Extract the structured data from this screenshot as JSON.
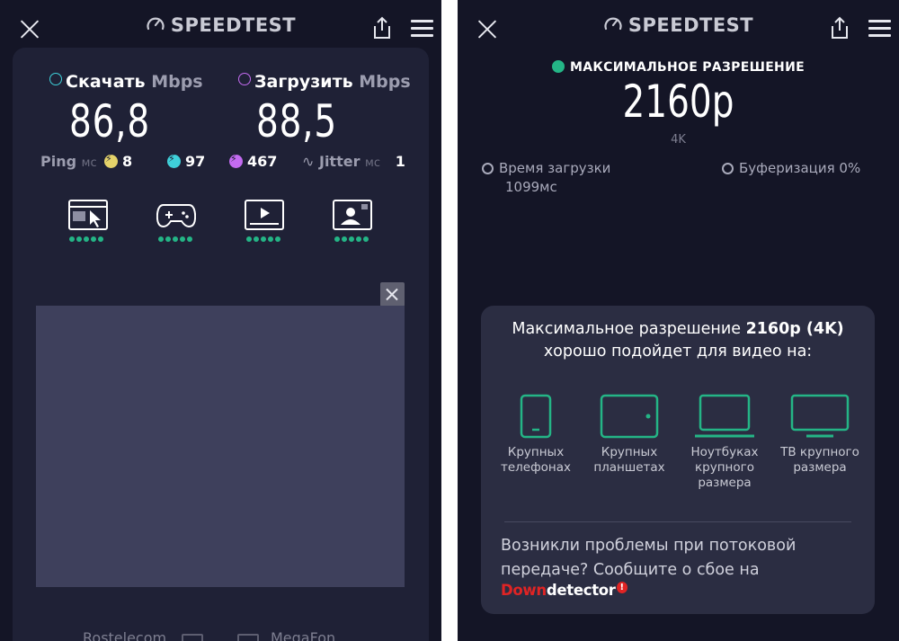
{
  "brand": "SPEEDTEST",
  "left": {
    "download": {
      "label": "Скачать",
      "unit": "Mbps",
      "value": "86,8"
    },
    "upload": {
      "label": "Загрузить",
      "unit": "Mbps",
      "value": "88,5"
    },
    "ping": {
      "label": "Ping",
      "unit": "мс",
      "idle": "8",
      "download": "97",
      "upload": "467"
    },
    "jitter": {
      "label": "Jitter",
      "unit": "мс",
      "value": "1"
    },
    "activities": [
      {
        "name": "web-browsing",
        "rating": 5
      },
      {
        "name": "gaming",
        "rating": 5
      },
      {
        "name": "video-streaming",
        "rating": 5
      },
      {
        "name": "video-chat",
        "rating": 5
      }
    ],
    "providers": [
      "Rostelecom",
      "MegaFon"
    ]
  },
  "right": {
    "title": "МАКСИМАЛЬНОЕ РАЗРЕШЕНИЕ",
    "resolution": "2160p",
    "resolution_sub": "4K",
    "load_time_label": "Время загрузки",
    "load_time_value": "1099мс",
    "buffering_label": "Буферизация 0%",
    "info_line1_prefix": "Максимальное разрешение ",
    "info_line1_bold": "2160p (4K)",
    "info_line2": "хорошо подойдет для видео на:",
    "devices": [
      {
        "label": "Крупных телефонах"
      },
      {
        "label": "Крупных планшетах"
      },
      {
        "label": "Ноутбуках крупного размера"
      },
      {
        "label": "ТВ крупного размера"
      }
    ],
    "problem_text": "Возникли проблемы при потоковой передаче? Сообщите о сбое на",
    "downdetector_red": "Down",
    "downdetector_white": "detector",
    "downdetector_badge": "!"
  },
  "colors": {
    "background": "#141526",
    "card": "#1f2136",
    "accent_green": "#24b586",
    "download_cyan": "#3fd0d9",
    "upload_purple": "#c36bf0",
    "ping_yellow": "#e5d36a"
  }
}
